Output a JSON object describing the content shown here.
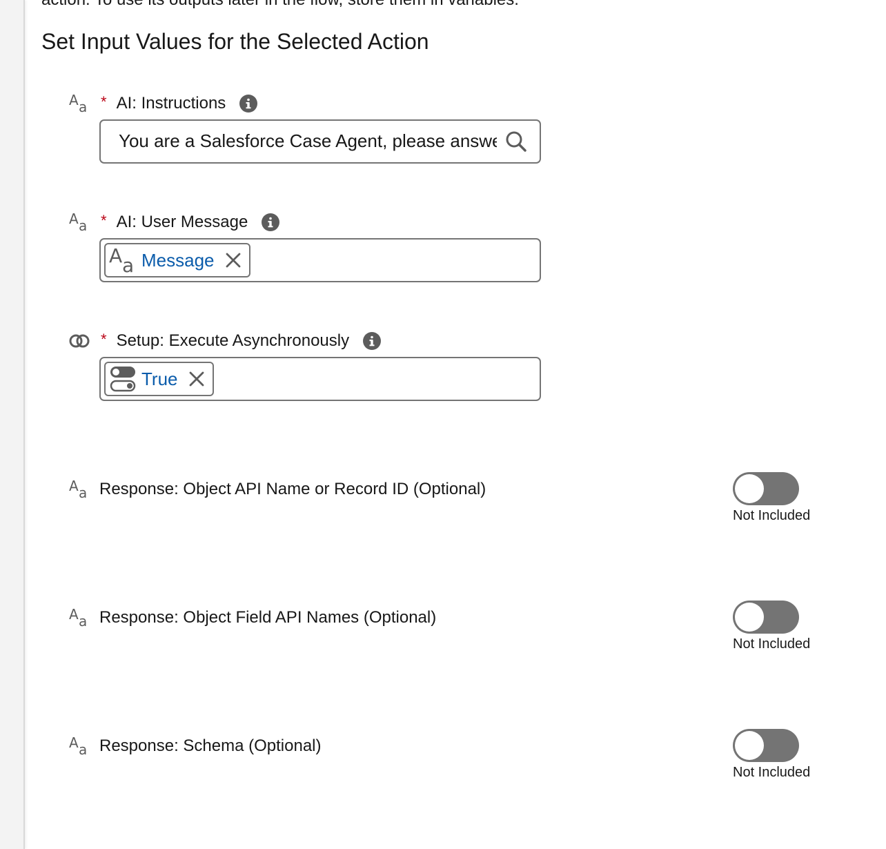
{
  "header": {
    "cut_off_text": "action. To use its outputs later in the flow, store them in variables.",
    "section_title": "Set Input Values for the Selected Action"
  },
  "fields": {
    "instructions": {
      "label": "AI: Instructions",
      "required_mark": "*",
      "type_icon": "text-type-icon",
      "value": "You are a Salesforce Case Agent, please answer"
    },
    "user_message": {
      "label": "AI: User Message",
      "required_mark": "*",
      "type_icon": "text-type-icon",
      "pill_label": "Message"
    },
    "execute_async": {
      "label": "Setup: Execute Asynchronously",
      "required_mark": "*",
      "type_icon": "boolean-type-icon",
      "pill_label": "True"
    }
  },
  "optional_fields": [
    {
      "label": "Response: Object API Name or Record ID (Optional)",
      "status": "Not Included",
      "included": false
    },
    {
      "label": "Response: Object Field API Names (Optional)",
      "status": "Not Included",
      "included": false
    },
    {
      "label": "Response: Schema (Optional)",
      "status": "Not Included",
      "included": false
    }
  ],
  "colors": {
    "required": "#ba0517",
    "pill_text": "#0b5cab",
    "toggle_off": "#747474",
    "icon_gray": "#5c5c5c"
  }
}
